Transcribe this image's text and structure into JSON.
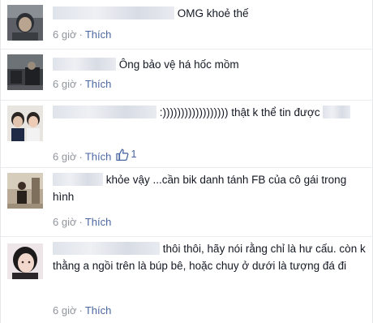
{
  "comments": [
    {
      "text": "OMG khoẻ thế",
      "time": "6 giờ",
      "separator": "·",
      "like_label": "Thích",
      "like_count": ""
    },
    {
      "text": "Ông bảo vệ há hốc mồm",
      "time": "6 giờ",
      "separator": "·",
      "like_label": "Thích",
      "like_count": ""
    },
    {
      "text": ":)))))))))))))))))) thật k thể tin được",
      "time": "6 giờ",
      "separator": "·",
      "like_label": "Thích",
      "like_count": "1"
    },
    {
      "text": "khỏe vậy ...cần bik danh tánh FB của cô gái trong hình",
      "time": "6 giờ",
      "separator": "·",
      "like_label": "Thích",
      "like_count": ""
    },
    {
      "text": "thôi thôi, hãy nói rằng chỉ là hư cấu. còn k thằng a ngồi trên là búp bê, hoặc chuy ở dưới là tượng đá đi",
      "time": "6 giờ",
      "separator": "·",
      "like_label": "Thích",
      "like_count": ""
    }
  ],
  "icons": {
    "like_count_icon": "thumbs-up-icon"
  },
  "colors": {
    "link": "#4b67a1",
    "meta": "#90949c",
    "text": "#141823",
    "divider": "#e9ebee"
  }
}
